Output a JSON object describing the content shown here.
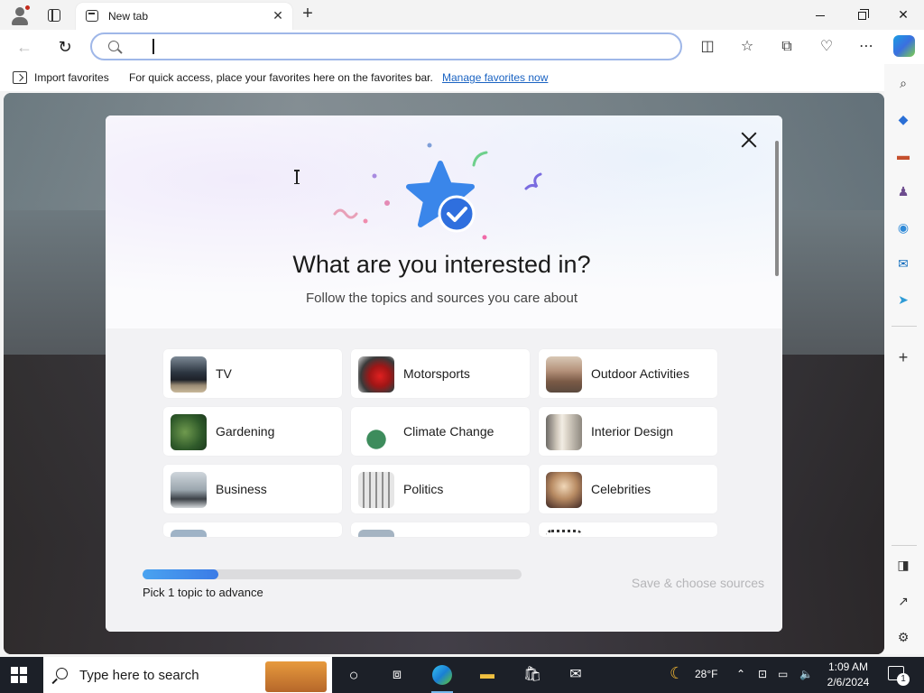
{
  "browser": {
    "tab_title": "New tab",
    "address_value": "",
    "favorites_bar": {
      "import_label": "Import favorites",
      "hint": "For quick access, place your favorites here on the favorites bar.",
      "manage_link": "Manage favorites now"
    }
  },
  "modal": {
    "title": "What are you interested in?",
    "subtitle": "Follow the topics and sources you care about",
    "topics": [
      {
        "label": "TV",
        "icon": "tv-thumbnail"
      },
      {
        "label": "Motorsports",
        "icon": "motorsports-thumbnail"
      },
      {
        "label": "Outdoor Activities",
        "icon": "outdoor-thumbnail"
      },
      {
        "label": "Gardening",
        "icon": "gardening-thumbnail"
      },
      {
        "label": "Climate Change",
        "icon": "climate-thumbnail"
      },
      {
        "label": "Interior Design",
        "icon": "interior-thumbnail"
      },
      {
        "label": "Business",
        "icon": "business-thumbnail"
      },
      {
        "label": "Politics",
        "icon": "politics-thumbnail"
      },
      {
        "label": "Celebrities",
        "icon": "celebrities-thumbnail"
      }
    ],
    "progress": {
      "fraction": 0.2,
      "text": "Pick 1 topic to advance"
    },
    "save_button": "Save & choose sources"
  },
  "taskbar": {
    "search_placeholder": "Type here to search",
    "weather": "28°F",
    "time": "1:09 AM",
    "date": "2/6/2024",
    "notification_count": "1"
  },
  "colors": {
    "accent": "#3b7be6",
    "link": "#1a63c2",
    "taskbar": "#1c2028"
  }
}
